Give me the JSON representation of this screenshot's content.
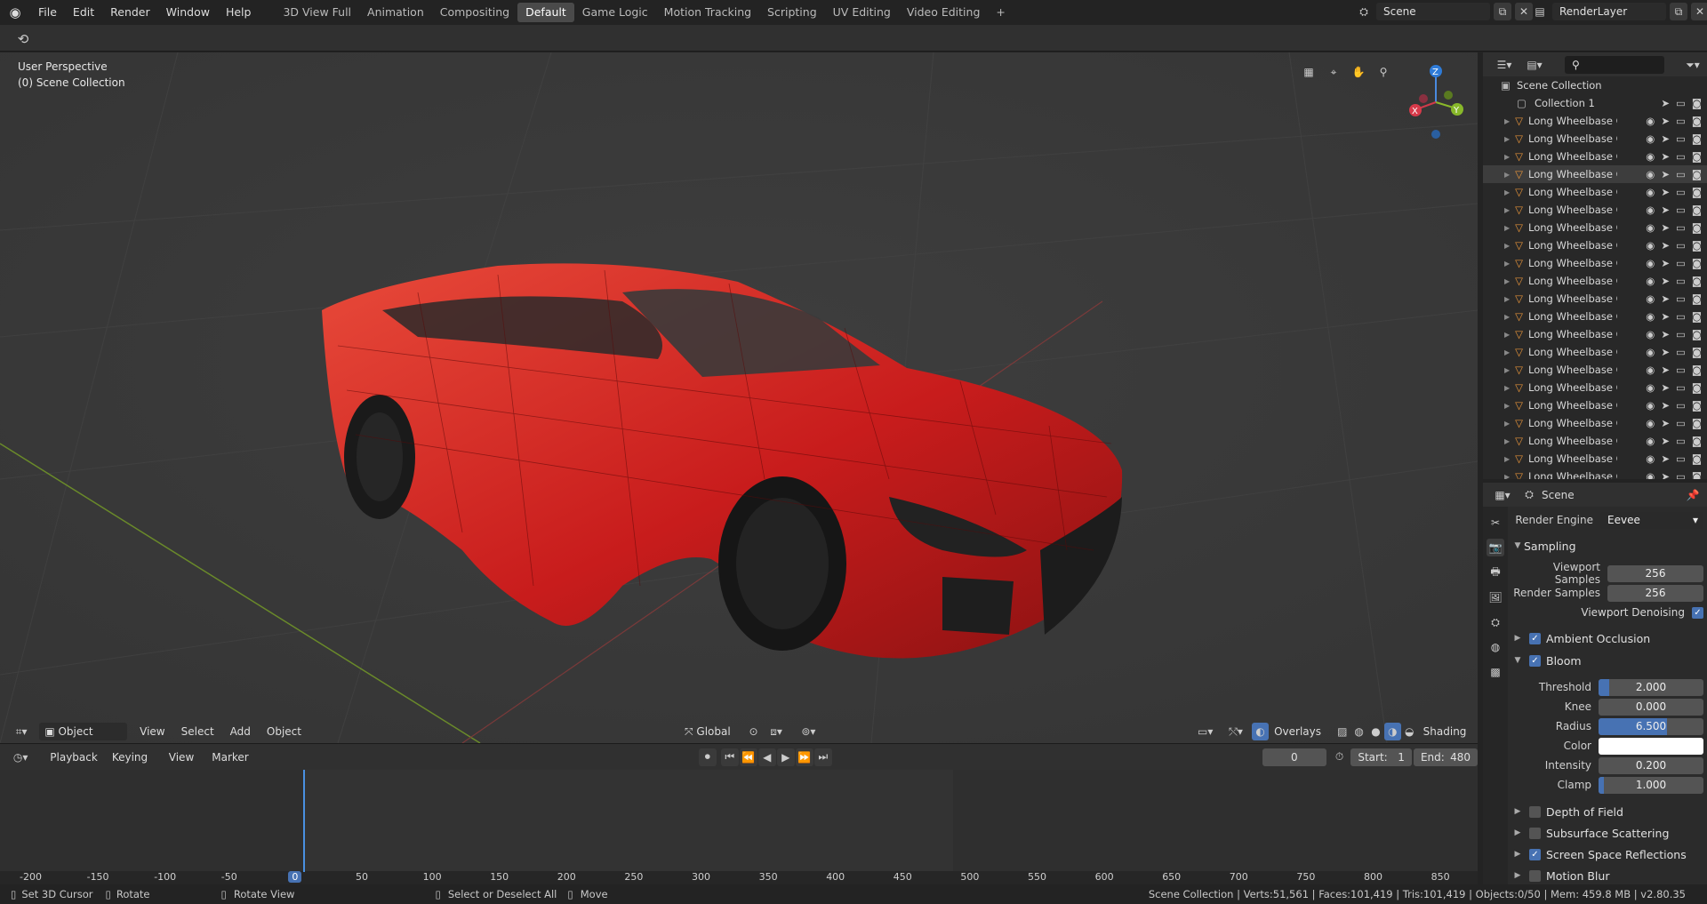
{
  "topbar": {
    "menus": [
      "File",
      "Edit",
      "Render",
      "Window",
      "Help"
    ],
    "workspaces": [
      "3D View Full",
      "Animation",
      "Compositing",
      "Default",
      "Game Logic",
      "Motion Tracking",
      "Scripting",
      "UV Editing",
      "Video Editing"
    ],
    "active_workspace": "Default",
    "add_tab": "+",
    "scene_name": "Scene",
    "render_layer": "RenderLayer"
  },
  "viewport": {
    "perspective": "User Perspective",
    "collection": "(0) Scene Collection",
    "mode": "Object Mode",
    "menus": [
      "View",
      "Select",
      "Add",
      "Object"
    ],
    "transform_orientation": "Global",
    "overlays": "Overlays",
    "shading": "Shading",
    "gizmo": {
      "x": "X",
      "y": "Y",
      "z": "Z"
    },
    "car_color": "#d42424"
  },
  "timeline": {
    "menus": [
      "Playback",
      "Keying",
      "View",
      "Marker"
    ],
    "current_frame": "0",
    "start_label": "Start:",
    "start": "1",
    "end_label": "End:",
    "end": "480",
    "ruler": [
      "-200",
      "-150",
      "-100",
      "-50",
      "0",
      "50",
      "100",
      "150",
      "200",
      "250",
      "300",
      "350",
      "400",
      "450",
      "500",
      "550",
      "600",
      "650",
      "700",
      "750",
      "800",
      "850"
    ],
    "playhead": "0"
  },
  "statusbar": {
    "hints": [
      "Set 3D Cursor",
      "Rotate",
      "Rotate View",
      "Select or Deselect All",
      "Move"
    ],
    "stats": "Scene Collection | Verts:51,561 | Faces:101,419 | Tris:101,419 | Objects:0/50 | Mem: 459.8 MB | v2.80.35"
  },
  "outliner": {
    "root": "Scene Collection",
    "collection": "Collection 1",
    "items": [
      "Long Wheelbase Car",
      "Long Wheelbase Car",
      "Long Wheelbase Car",
      "Long Wheelbase Car",
      "Long Wheelbase Car",
      "Long Wheelbase Car",
      "Long Wheelbase Car",
      "Long Wheelbase Car",
      "Long Wheelbase Car",
      "Long Wheelbase Car",
      "Long Wheelbase Car",
      "Long Wheelbase Car",
      "Long Wheelbase Car",
      "Long Wheelbase Car",
      "Long Wheelbase Car",
      "Long Wheelbase Car",
      "Long Wheelbase Car",
      "Long Wheelbase Car",
      "Long Wheelbase Car",
      "Long Wheelbase Car",
      "Long Wheelbase Car"
    ],
    "selected_index": 3
  },
  "properties": {
    "context": "Scene",
    "render_engine_label": "Render Engine",
    "render_engine": "Eevee",
    "sampling": "Sampling",
    "viewport_samples_label": "Viewport Samples",
    "viewport_samples": "256",
    "render_samples_label": "Render Samples",
    "render_samples": "256",
    "viewport_denoising": "Viewport Denoising",
    "ambient_occlusion": "Ambient Occlusion",
    "bloom": "Bloom",
    "threshold_label": "Threshold",
    "threshold": "2.000",
    "threshold_fill": 0.1,
    "knee_label": "Knee",
    "knee": "0.000",
    "radius_label": "Radius",
    "radius": "6.500",
    "radius_fill": 0.65,
    "color_label": "Color",
    "intensity_label": "Intensity",
    "intensity": "0.200",
    "clamp_label": "Clamp",
    "clamp": "1.000",
    "clamp_fill": 0.05,
    "depth_of_field": "Depth of Field",
    "subsurface_scattering": "Subsurface Scattering",
    "screen_space_reflections": "Screen Space Reflections",
    "motion_blur": "Motion Blur"
  }
}
